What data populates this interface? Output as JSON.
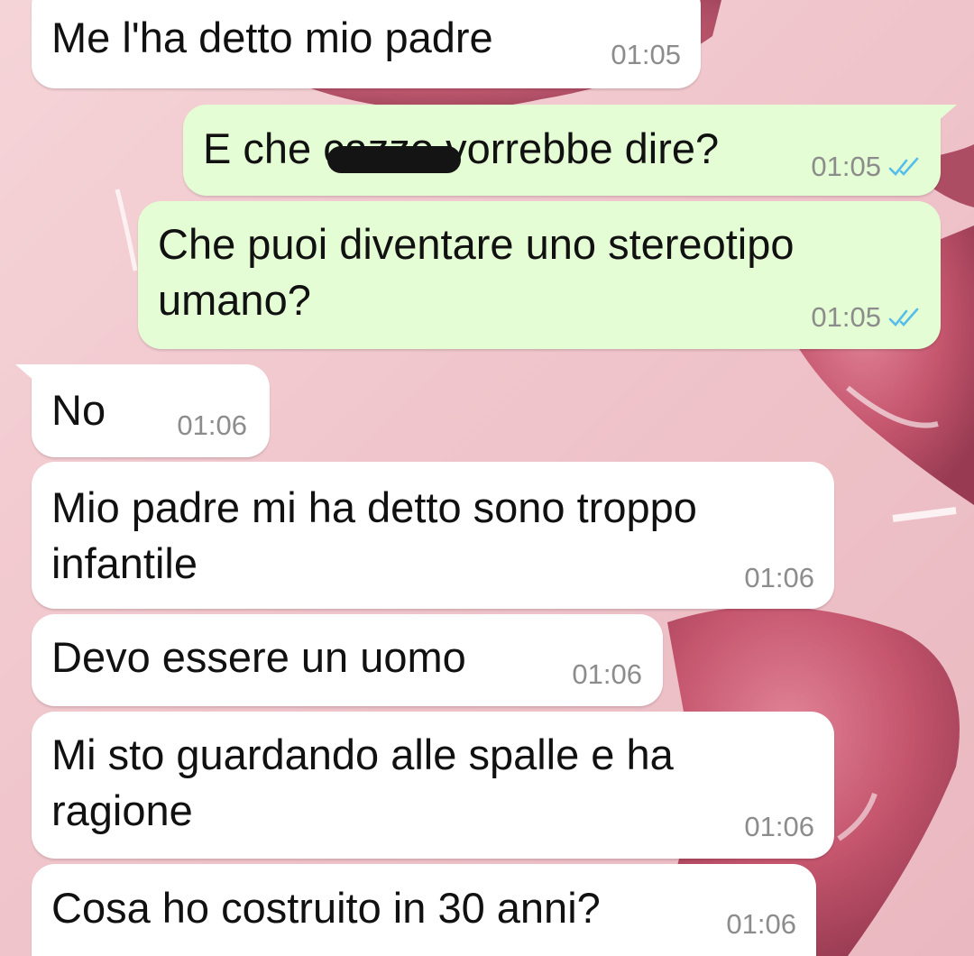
{
  "theme": {
    "incoming_bubble": "#ffffff",
    "outgoing_bubble": "#e4fdd4",
    "read_ticks_color": "#53bdeb",
    "wallpaper_base": "#efc7cc",
    "wallpaper_heart": "#c04a64"
  },
  "messages": [
    {
      "direction": "in",
      "text": "Me l'ha detto mio padre",
      "time": "01:05"
    },
    {
      "direction": "out",
      "text": "E che cazzo vorrebbe dire?",
      "time": "01:05",
      "status": "read",
      "status_icon": "double-check-icon",
      "redacted_word": "cazzo"
    },
    {
      "direction": "out",
      "text": "Che puoi diventare uno stereotipo\numano?",
      "time": "01:05",
      "status": "read",
      "status_icon": "double-check-icon"
    },
    {
      "direction": "in",
      "text": "No",
      "time": "01:06"
    },
    {
      "direction": "in",
      "text": "Mio padre mi ha detto sono troppo\ninfantile",
      "time": "01:06"
    },
    {
      "direction": "in",
      "text": "Devo essere un uomo",
      "time": "01:06"
    },
    {
      "direction": "in",
      "text": "Mi sto guardando alle spalle e ha\nragione",
      "time": "01:06"
    },
    {
      "direction": "in",
      "text": "Cosa ho costruito in 30 anni?",
      "time": "01:06"
    }
  ]
}
